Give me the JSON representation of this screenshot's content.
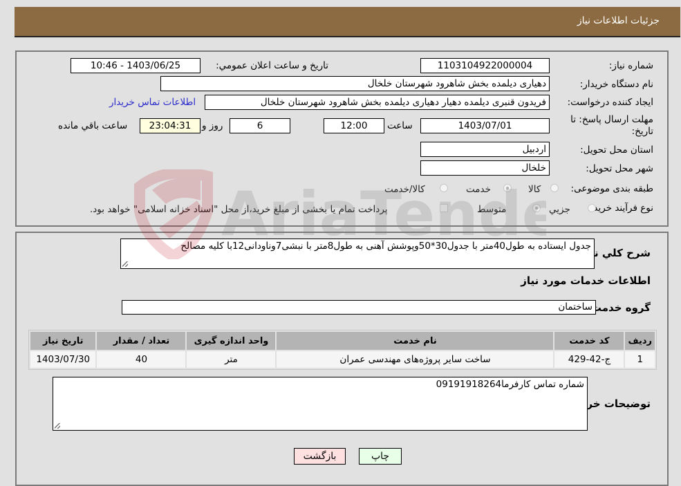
{
  "header": {
    "title": "جزئیات اطلاعات نیاز"
  },
  "form": {
    "need_number": {
      "label": "شماره نیاز:",
      "value": "1103104922000004"
    },
    "announce_datetime": {
      "label": "تاریخ و ساعت اعلان عمومي:",
      "value": "1403/06/25 - 10:46"
    },
    "buyer_org": {
      "label": "نام دستگاه خريدار:",
      "value": "دهیاری دیلمده بخش شاهرود شهرستان خلخال"
    },
    "requester": {
      "label": "ایجاد کننده درخواست:",
      "value": "فریدون قنبری دیلمده دهیار دهیاری دیلمده بخش شاهرود شهرستان خلخال"
    },
    "buyer_contact_link": "اطلاعات تماس خریدار",
    "deadline": {
      "label": "مهلت ارسال پاسخ: تا تاریخ:",
      "date": "1403/07/01",
      "time_label": "ساعت",
      "time": "12:00",
      "days": "6",
      "days_label": "روز و",
      "remaining": "23:04:31",
      "remaining_label": "ساعت باقي مانده"
    },
    "province": {
      "label": "استان محل تحویل:",
      "value": "اردبیل"
    },
    "city": {
      "label": "شهر محل تحویل:",
      "value": "خلخال"
    },
    "category": {
      "label": "طبقه بندی موضوعی:",
      "options": [
        {
          "label": "کالا",
          "checked": false
        },
        {
          "label": "خدمت",
          "checked": true
        },
        {
          "label": "کالا/خدمت",
          "checked": false
        }
      ]
    },
    "purchase_type": {
      "label": "نوع فرآیند خرید :",
      "options": [
        {
          "label": "جزيي",
          "checked": false
        },
        {
          "label": "متوسط",
          "checked": true
        }
      ],
      "treasury_checkbox": {
        "label": "پرداخت تمام یا بخشی از مبلغ خرید،از محل \"اسناد خزانه اسلامی\" خواهد بود.",
        "checked": false
      }
    }
  },
  "details": {
    "description_label": "شرح کلي نياز:",
    "description": "جدول ایستاده به طول40متر با جدول30*50وپوشش آهنی به طول8متر با نبشی7وناودانی12با کلیه مصالح",
    "services_title": "اطلاعات خدمات مورد نياز",
    "service_group_label": "گروه خدمت:",
    "service_group": "ساختمان",
    "table": {
      "headers": [
        "رديف",
        "کد خدمت",
        "نام خدمت",
        "واحد اندازه گيری",
        "تعداد / مقدار",
        "تاريخ نياز"
      ],
      "rows": [
        [
          "1",
          "ج-42-429",
          "ساخت سایر پروژه‌های مهندسی عمران",
          "متر",
          "40",
          "1403/07/30"
        ]
      ]
    },
    "buyer_notes_label": "توضیحات خریدار:",
    "buyer_notes": "شماره تماس کارفرما09191918264"
  },
  "buttons": {
    "print": "چاپ",
    "back": "بازگشت"
  },
  "watermark": {
    "text": "AriaTender.neT"
  },
  "colors": {
    "header_bg": "#8d6b42",
    "back_button_bg": "#ffe0e0",
    "print_button_bg": "#e8ffe8",
    "link": "#2a2acc"
  }
}
